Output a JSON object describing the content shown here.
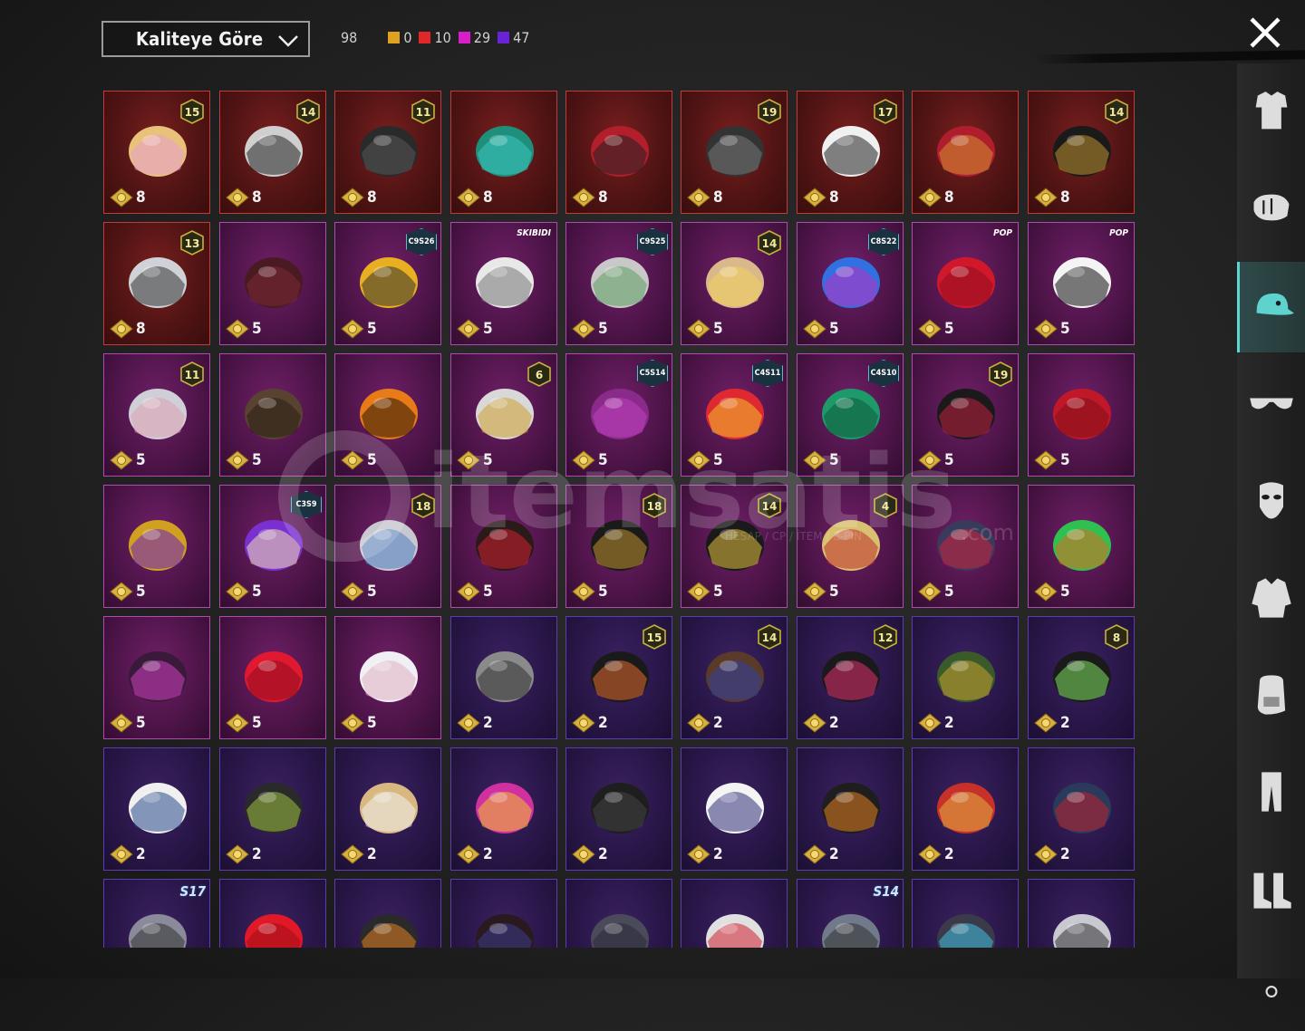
{
  "filter": {
    "sort_label": "Kaliteye Göre"
  },
  "counts": {
    "total": "98",
    "items": [
      {
        "color": "#e0a020",
        "value": "0"
      },
      {
        "color": "#e02828",
        "value": "10"
      },
      {
        "color": "#d81ec8",
        "value": "29"
      },
      {
        "color": "#6a22d8",
        "value": "47"
      }
    ]
  },
  "watermark": {
    "brand": "itemsatis",
    "domain": ".com",
    "tagline": "HESAP / CP / İTEM / E-PİN"
  },
  "rows": [
    [
      {
        "quality": "red",
        "pts": "8",
        "badge": "15",
        "art": "blonde-hair"
      },
      {
        "quality": "red",
        "pts": "8",
        "badge": "14",
        "art": "cat-mask"
      },
      {
        "quality": "red",
        "pts": "8",
        "badge": "11",
        "art": "dark-helmet"
      },
      {
        "quality": "red",
        "pts": "8",
        "badge": "",
        "art": "dragon-helmet"
      },
      {
        "quality": "red",
        "pts": "8",
        "badge": "",
        "art": "horned-helmet"
      },
      {
        "quality": "red",
        "pts": "8",
        "badge": "19",
        "art": "ninja-helmet"
      },
      {
        "quality": "red",
        "pts": "8",
        "badge": "17",
        "art": "white-hair"
      },
      {
        "quality": "red",
        "pts": "8",
        "badge": "",
        "art": "red-helmet"
      },
      {
        "quality": "red",
        "pts": "8",
        "badge": "14",
        "art": "pharaoh-hair"
      }
    ],
    [
      {
        "quality": "red",
        "pts": "8",
        "badge": "13",
        "art": "gas-mask"
      },
      {
        "quality": "pink",
        "pts": "5",
        "badge": "",
        "art": "brown-hair"
      },
      {
        "quality": "pink",
        "pts": "5",
        "tag": "C9S26",
        "art": "bee-hat"
      },
      {
        "quality": "pink",
        "pts": "5",
        "text": "SKIBIDI",
        "art": "camera-head"
      },
      {
        "quality": "pink",
        "pts": "5",
        "tag": "C9S25",
        "art": "grey-hair"
      },
      {
        "quality": "pink",
        "pts": "5",
        "badge": "14",
        "art": "blonde-flower"
      },
      {
        "quality": "pink",
        "pts": "5",
        "tag": "C8S22",
        "art": "blue-pink-hair"
      },
      {
        "quality": "pink",
        "pts": "5",
        "text": "POP",
        "art": "red-hair"
      },
      {
        "quality": "pink",
        "pts": "5",
        "text": "POP",
        "art": "panda-head"
      }
    ],
    [
      {
        "quality": "pink",
        "pts": "5",
        "badge": "11",
        "art": "grey-veil"
      },
      {
        "quality": "pink",
        "pts": "5",
        "badge": "",
        "art": "thin-braid"
      },
      {
        "quality": "pink",
        "pts": "5",
        "badge": "",
        "art": "pumpkin-head"
      },
      {
        "quality": "pink",
        "pts": "5",
        "badge": "6",
        "art": "wing-mask"
      },
      {
        "quality": "pink",
        "pts": "5",
        "tag": "C5S14",
        "art": "purple-hair"
      },
      {
        "quality": "pink",
        "pts": "5",
        "tag": "C4S11",
        "art": "red-cap"
      },
      {
        "quality": "pink",
        "pts": "5",
        "tag": "C4S10",
        "art": "green-helmet"
      },
      {
        "quality": "pink",
        "pts": "5",
        "badge": "19",
        "art": "black-bun"
      },
      {
        "quality": "pink",
        "pts": "5",
        "badge": "",
        "art": "red-pigtails"
      }
    ],
    [
      {
        "quality": "pink",
        "pts": "5",
        "badge": "",
        "art": "luchador-mask"
      },
      {
        "quality": "pink",
        "pts": "5",
        "tag": "C3S9",
        "art": "purple-cap"
      },
      {
        "quality": "pink",
        "pts": "5",
        "badge": "18",
        "art": "silver-hair"
      },
      {
        "quality": "pink",
        "pts": "5",
        "badge": "",
        "art": "red-bandana"
      },
      {
        "quality": "pink",
        "pts": "5",
        "badge": "18",
        "art": "black-bun-2"
      },
      {
        "quality": "pink",
        "pts": "5",
        "badge": "14",
        "art": "gold-tiara"
      },
      {
        "quality": "pink",
        "pts": "5",
        "badge": "4",
        "art": "samurai-helmet"
      },
      {
        "quality": "pink",
        "pts": "5",
        "badge": "",
        "art": "spiked-hat"
      },
      {
        "quality": "pink",
        "pts": "5",
        "badge": "",
        "art": "frog-hat"
      }
    ],
    [
      {
        "quality": "pink",
        "pts": "5",
        "badge": "",
        "art": "witch-hat"
      },
      {
        "quality": "pink",
        "pts": "5",
        "badge": "",
        "art": "devil-horns"
      },
      {
        "quality": "pink",
        "pts": "5",
        "badge": "",
        "art": "white-bucket-hat"
      },
      {
        "quality": "purple",
        "pts": "2",
        "badge": "",
        "art": "grey-wig"
      },
      {
        "quality": "purple",
        "pts": "2",
        "badge": "15",
        "art": "pumpkin-beanie"
      },
      {
        "quality": "purple",
        "pts": "2",
        "badge": "14",
        "art": "cat-cap-hair"
      },
      {
        "quality": "purple",
        "pts": "2",
        "badge": "12",
        "art": "bunny-helmet"
      },
      {
        "quality": "purple",
        "pts": "2",
        "badge": "",
        "art": "officer-cap"
      },
      {
        "quality": "purple",
        "pts": "2",
        "badge": "8",
        "art": "alien-hood"
      }
    ],
    [
      {
        "quality": "purple",
        "pts": "2",
        "badge": "",
        "art": "white-cap"
      },
      {
        "quality": "purple",
        "pts": "2",
        "badge": "",
        "art": "military-helmet"
      },
      {
        "quality": "purple",
        "pts": "2",
        "badge": "",
        "art": "bunny-bucket"
      },
      {
        "quality": "purple",
        "pts": "2",
        "badge": "",
        "art": "pink-butterfly"
      },
      {
        "quality": "purple",
        "pts": "2",
        "badge": "",
        "art": "black-cap"
      },
      {
        "quality": "purple",
        "pts": "2",
        "badge": "",
        "art": "white-sunhat"
      },
      {
        "quality": "purple",
        "pts": "2",
        "badge": "",
        "art": "black-snapback"
      },
      {
        "quality": "purple",
        "pts": "2",
        "badge": "",
        "art": "gold-cap"
      },
      {
        "quality": "purple",
        "pts": "2",
        "badge": "",
        "art": "denim-bucket"
      }
    ],
    [
      {
        "quality": "purple",
        "pts": "",
        "wing": "S17",
        "art": "viking-helmet"
      },
      {
        "quality": "purple",
        "pts": "",
        "badge": "",
        "art": "red-mohawk"
      },
      {
        "quality": "purple",
        "pts": "",
        "badge": "",
        "art": "tech-helmet"
      },
      {
        "quality": "purple",
        "pts": "",
        "badge": "",
        "art": "dark-hair"
      },
      {
        "quality": "purple",
        "pts": "",
        "badge": "",
        "art": "grey-cap"
      },
      {
        "quality": "purple",
        "pts": "",
        "badge": "",
        "art": "flag-helmet"
      },
      {
        "quality": "purple",
        "pts": "",
        "wing": "S14",
        "art": "knight-helmet"
      },
      {
        "quality": "purple",
        "pts": "",
        "badge": "",
        "art": "goggle-helmet"
      },
      {
        "quality": "purple",
        "pts": "",
        "badge": "",
        "art": "silver-mask"
      }
    ]
  ],
  "sidebar": [
    {
      "name": "outfit-icon",
      "active": false
    },
    {
      "name": "fist-icon",
      "active": false
    },
    {
      "name": "cap-icon",
      "active": true
    },
    {
      "name": "glasses-icon",
      "active": false
    },
    {
      "name": "mask-icon",
      "active": false
    },
    {
      "name": "jacket-icon",
      "active": false
    },
    {
      "name": "backpack-icon",
      "active": false
    },
    {
      "name": "pants-icon",
      "active": false
    },
    {
      "name": "boots-icon",
      "active": false
    },
    {
      "name": "more-icon",
      "active": false
    }
  ]
}
